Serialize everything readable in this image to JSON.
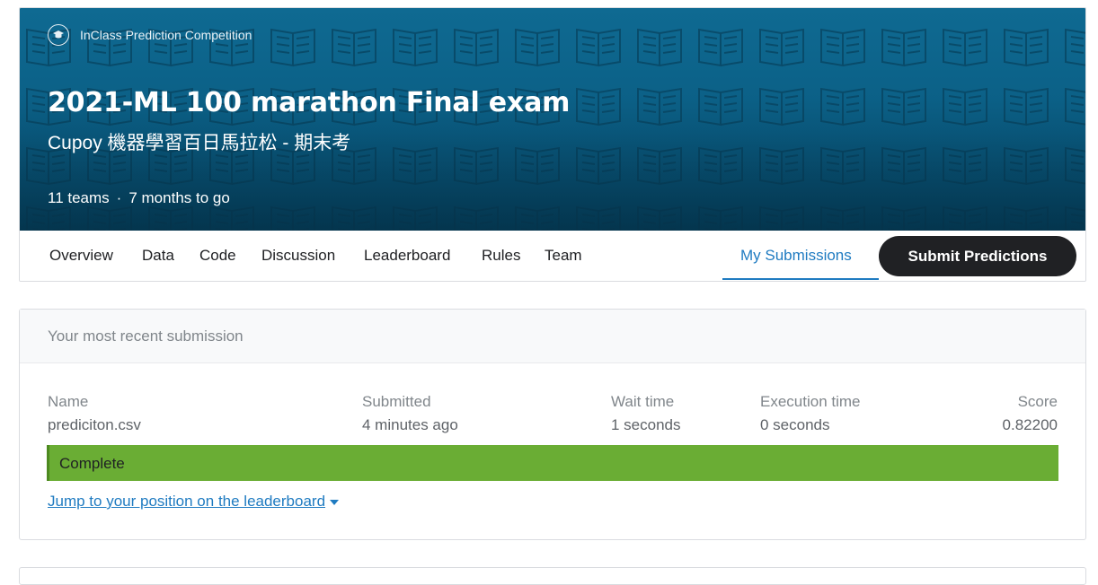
{
  "header": {
    "badge_icon": "graduation-cap-icon",
    "badge_label": "InClass Prediction Competition",
    "title": "2021-ML 100 marathon Final exam",
    "subtitle": "Cupoy 機器學習百日馬拉松 - 期末考",
    "teams": "11 teams",
    "separator": "·",
    "time_left": "7 months to go",
    "background_color": "#0a5d83"
  },
  "tabs": {
    "items": [
      {
        "label": "Overview"
      },
      {
        "label": "Data"
      },
      {
        "label": "Code"
      },
      {
        "label": "Discussion"
      },
      {
        "label": "Leaderboard"
      },
      {
        "label": "Rules"
      },
      {
        "label": "Team"
      }
    ],
    "active": {
      "label": "My Submissions"
    },
    "submit_label": "Submit Predictions",
    "accent_color": "#1f7bc1"
  },
  "submission": {
    "header": "Your most recent submission",
    "columns": {
      "name": {
        "label": "Name",
        "value": "prediciton.csv"
      },
      "submitted": {
        "label": "Submitted",
        "value": "4 minutes ago"
      },
      "wait": {
        "label": "Wait time",
        "value": "1 seconds"
      },
      "execution": {
        "label": "Execution time",
        "value": "0 seconds"
      },
      "score": {
        "label": "Score",
        "value": "0.82200"
      }
    },
    "status": "Complete",
    "status_color": "#6aad34",
    "jump_link": "Jump to your position on the leaderboard",
    "jump_icon": "caret-down-icon"
  }
}
